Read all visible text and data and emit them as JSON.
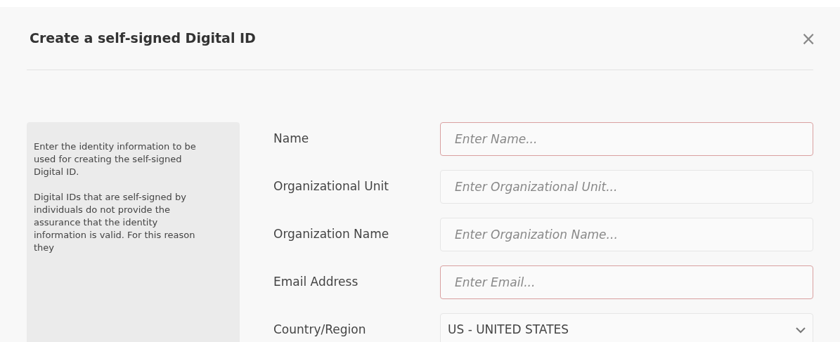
{
  "dialog": {
    "title": "Create a self-signed Digital ID",
    "close": "×"
  },
  "help_panel": {
    "paragraphs": [
      "Enter the identity information to be used for creating the self-signed Digital ID.",
      "Digital IDs that are self-signed by individuals do not provide the assurance that the identity information is valid. For this reason they"
    ]
  },
  "fields": [
    {
      "kind": "text",
      "label": "Name",
      "placeholder": "Enter Name...",
      "invalid": true
    },
    {
      "kind": "text",
      "label": "Organizational Unit",
      "placeholder": "Enter Organizational Unit...",
      "invalid": false
    },
    {
      "kind": "text",
      "label": "Organization Name",
      "placeholder": "Enter Organization Name...",
      "invalid": false
    },
    {
      "kind": "text",
      "label": "Email Address",
      "placeholder": "Enter Email...",
      "invalid": true
    },
    {
      "kind": "select",
      "label": "Country/Region",
      "value": "US - UNITED STATES",
      "invalid": false
    }
  ]
}
